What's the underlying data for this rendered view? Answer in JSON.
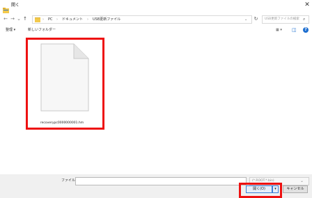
{
  "window": {
    "title": "開く",
    "close_glyph": "✕"
  },
  "nav": {
    "back": "←",
    "forward": "→",
    "recent": "⌄",
    "up": "↑",
    "breadcrumb": [
      "PC",
      "ドキュメント",
      "USB更新ファイル"
    ],
    "separator": "›",
    "address_chevron": "⌄",
    "refresh": "↻",
    "search_placeholder": "USB更新ファイルの検索",
    "search_glyph": "⌕"
  },
  "toolbar": {
    "organize_label": "整理 ▾",
    "new_folder_label": "新しいフォルダー",
    "view_glyph": "▦ ▾",
    "preview_glyph": "◫",
    "help_glyph": "?"
  },
  "files": [
    {
      "name": "recoverypc0000000001.hm"
    }
  ],
  "bottom": {
    "filename_label": "ファイル名(N):",
    "filename_value": "",
    "filter_value": "(*.ROOT.*.bin)",
    "filter_chevron": "⌄",
    "open_label": "開く(O)",
    "open_arrow": "▾",
    "cancel_label": "キャンセル"
  },
  "colors": {
    "highlight": "#ee1111",
    "accent": "#3c7fd6",
    "help": "#1e6fd0"
  }
}
